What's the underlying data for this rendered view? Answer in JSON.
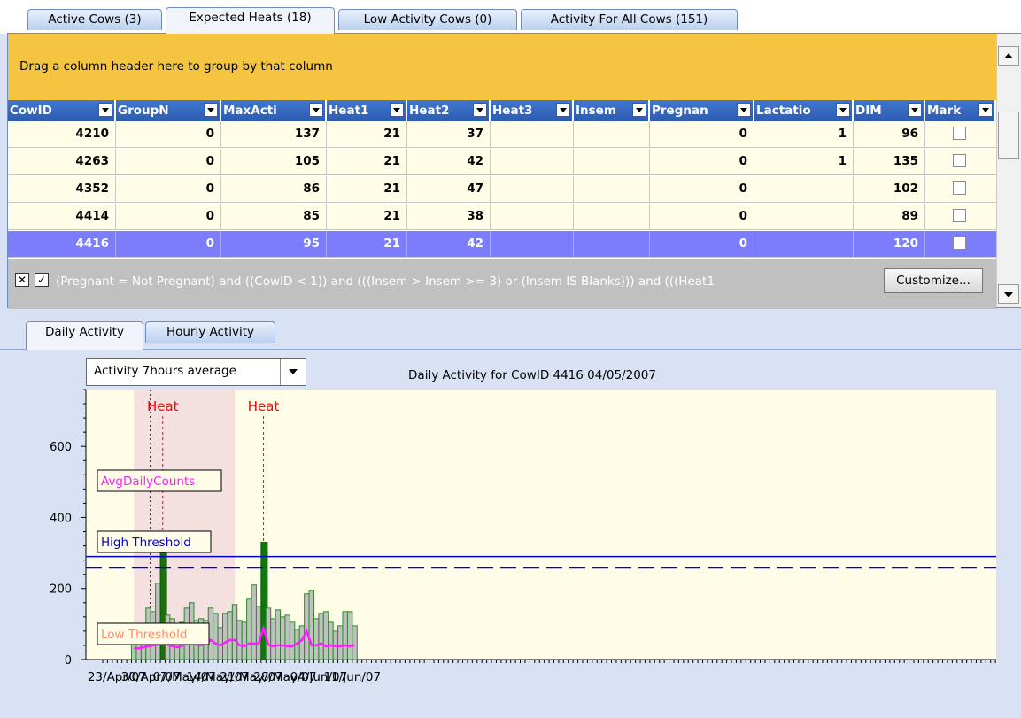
{
  "tabs": [
    {
      "label": "Active Cows (3)"
    },
    {
      "label": "Expected Heats (18)"
    },
    {
      "label": "Low Activity Cows (0)"
    },
    {
      "label": "Activity For All Cows (151)"
    }
  ],
  "grid": {
    "group_hint": "Drag a column header here to group by that column",
    "columns": [
      "CowID",
      "GroupN",
      "MaxActi",
      "Heat1",
      "Heat2",
      "Heat3",
      "Insem",
      "Pregnan",
      "Lactatio",
      "DIM",
      "Mark"
    ],
    "rows": [
      {
        "cowid": "4210",
        "group": "0",
        "maxact": "137",
        "heat1": "21",
        "heat2": "37",
        "heat3": "",
        "insem": "",
        "pregnant": "0",
        "lactation": "1",
        "dim": "96"
      },
      {
        "cowid": "4263",
        "group": "0",
        "maxact": "105",
        "heat1": "21",
        "heat2": "42",
        "heat3": "",
        "insem": "",
        "pregnant": "0",
        "lactation": "1",
        "dim": "135"
      },
      {
        "cowid": "4352",
        "group": "0",
        "maxact": "86",
        "heat1": "21",
        "heat2": "47",
        "heat3": "",
        "insem": "",
        "pregnant": "0",
        "lactation": "",
        "dim": "102"
      },
      {
        "cowid": "4414",
        "group": "0",
        "maxact": "85",
        "heat1": "21",
        "heat2": "38",
        "heat3": "",
        "insem": "",
        "pregnant": "0",
        "lactation": "",
        "dim": "89"
      },
      {
        "cowid": "4416",
        "group": "0",
        "maxact": "95",
        "heat1": "21",
        "heat2": "42",
        "heat3": "",
        "insem": "",
        "pregnant": "0",
        "lactation": "",
        "dim": "120"
      }
    ],
    "filter_text": "(Pregnant = Not Pregnant) and ((CowID < 1)) and (((Insem > Insem  >= 3) or (Insem IS Blanks))) and (((Heat1",
    "customize_label": "Customize..."
  },
  "bottom_tabs": [
    {
      "label": "Daily Activity"
    },
    {
      "label": "Hourly Activity"
    }
  ],
  "dropdown": {
    "value": "Activity 7hours average"
  },
  "chart_data": {
    "type": "bar",
    "title": "Daily Activity for CowID 4416 04/05/2007",
    "ylim": [
      0,
      760
    ],
    "yticks": [
      0,
      200,
      400,
      600
    ],
    "x_start_date": "2007-04-20",
    "xticks": [
      {
        "day": 3,
        "label": "23/Apr/07"
      },
      {
        "day": 10,
        "label": "30/Apr/07"
      },
      {
        "day": 17,
        "label": "07/May/07"
      },
      {
        "day": 24,
        "label": "14/May/07"
      },
      {
        "day": 31,
        "label": "21/May/07"
      },
      {
        "day": 38,
        "label": "28/May/07"
      },
      {
        "day": 45,
        "label": "04/Jun/07"
      },
      {
        "day": 52,
        "label": "11/Jun/07"
      }
    ],
    "bar_first_day": 6,
    "bars": [
      95,
      95,
      95,
      145,
      135,
      215,
      350,
      125,
      115,
      90,
      105,
      145,
      160,
      110,
      115,
      110,
      145,
      130,
      90,
      130,
      135,
      155,
      110,
      105,
      170,
      210,
      150,
      330,
      145,
      115,
      140,
      120,
      125,
      105,
      85,
      95,
      185,
      195,
      115,
      130,
      135,
      105,
      80,
      95,
      135,
      135,
      95
    ],
    "heat_indices": [
      6,
      27
    ],
    "avg_daily_counts": [
      32,
      32,
      35,
      38,
      40,
      42,
      80,
      42,
      38,
      35,
      38,
      50,
      48,
      42,
      40,
      45,
      55,
      45,
      40,
      48,
      55,
      55,
      40,
      38,
      45,
      45,
      45,
      88,
      42,
      38,
      40,
      40,
      38,
      38,
      45,
      55,
      80,
      40,
      40,
      45,
      38,
      40,
      38,
      38,
      40,
      38,
      40
    ],
    "high_threshold": 290,
    "high_threshold_dashed": 258,
    "heat_label": "Heat",
    "heat_span_start_day": 6.5,
    "heat_span_end_day": 27.5,
    "blue_dotted_day": 9.9,
    "labels": {
      "avg": "AvgDailyCounts",
      "high": "High Threshold",
      "low": "Low Threshold"
    },
    "colors": {
      "bar": "#c0c0c0",
      "bar_edge": "#2b8a2b",
      "heat_bar": "#0a7a0a",
      "avg_line": "#ff1aff",
      "threshold": "#0000cc",
      "heat": "#ff0000",
      "shade": "#f5e0e0",
      "plot_bg": "#fffde8"
    }
  }
}
